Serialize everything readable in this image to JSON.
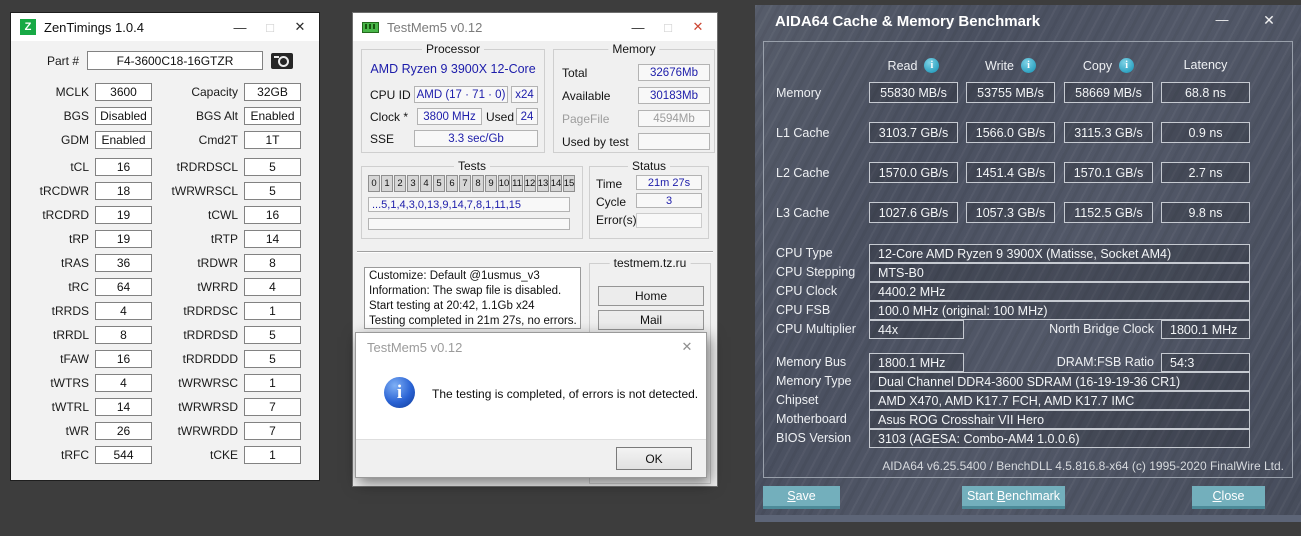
{
  "zentimings": {
    "icon_letter": "Z",
    "title": "ZenTimings 1.0.4",
    "minimize": "—",
    "maximize": "□",
    "close": "✕",
    "part_label": "Part #",
    "part_value": "F4-3600C18-16GTZR",
    "info_rows": [
      {
        "l1": "MCLK",
        "v1": "3600",
        "l2": "Capacity",
        "v2": "32GB"
      },
      {
        "l1": "BGS",
        "v1": "Disabled",
        "l2": "BGS Alt",
        "v2": "Enabled"
      },
      {
        "l1": "GDM",
        "v1": "Enabled",
        "l2": "Cmd2T",
        "v2": "1T"
      }
    ],
    "timing_rows": [
      {
        "l1": "tCL",
        "v1": "16",
        "l2": "tRDRDSCL",
        "v2": "5"
      },
      {
        "l1": "tRCDWR",
        "v1": "18",
        "l2": "tWRWRSCL",
        "v2": "5"
      },
      {
        "l1": "tRCDRD",
        "v1": "19",
        "l2": "tCWL",
        "v2": "16"
      },
      {
        "l1": "tRP",
        "v1": "19",
        "l2": "tRTP",
        "v2": "14"
      },
      {
        "l1": "tRAS",
        "v1": "36",
        "l2": "tRDWR",
        "v2": "8"
      },
      {
        "l1": "tRC",
        "v1": "64",
        "l2": "tWRRD",
        "v2": "4"
      },
      {
        "l1": "tRRDS",
        "v1": "4",
        "l2": "tRDRDSC",
        "v2": "1"
      },
      {
        "l1": "tRRDL",
        "v1": "8",
        "l2": "tRDRDSD",
        "v2": "5"
      },
      {
        "l1": "tFAW",
        "v1": "16",
        "l2": "tRDRDDD",
        "v2": "5"
      },
      {
        "l1": "tWTRS",
        "v1": "4",
        "l2": "tWRWRSC",
        "v2": "1"
      },
      {
        "l1": "tWTRL",
        "v1": "14",
        "l2": "tWRWRSD",
        "v2": "7"
      },
      {
        "l1": "tWR",
        "v1": "26",
        "l2": "tWRWRDD",
        "v2": "7"
      },
      {
        "l1": "tRFC",
        "v1": "544",
        "l2": "tCKE",
        "v2": "1"
      }
    ]
  },
  "testmem5": {
    "title": "TestMem5 v0.12",
    "minimize": "—",
    "maximize": "□",
    "close": "✕",
    "processor": {
      "group_label": "Processor",
      "cpu_name": "AMD Ryzen 9 3900X 12-Core",
      "cpu_id_label": "CPU ID",
      "cpu_id_value": "AMD  (17 · 71 · 0)",
      "cpu_id_mult": "x24",
      "clock_label": "Clock *",
      "clock_value": "3800 MHz",
      "used_label": "Used",
      "used_value": "24",
      "sse_label": "SSE",
      "sse_value": "3.3 sec/Gb"
    },
    "memory": {
      "group_label": "Memory",
      "rows": [
        {
          "label": "Total",
          "value": "32676Mb"
        },
        {
          "label": "Available",
          "value": "30183Mb"
        },
        {
          "label": "PageFile",
          "value": "4594Mb"
        },
        {
          "label": "Used by test",
          "value": ""
        }
      ]
    },
    "tests": {
      "group_label": "Tests",
      "buttons": [
        "0",
        "1",
        "2",
        "3",
        "4",
        "5",
        "6",
        "7",
        "8",
        "9",
        "10",
        "11",
        "12",
        "13",
        "14",
        "15"
      ],
      "sequence": "...5,1,4,3,0,13,9,14,7,8,1,11,15",
      "current": ""
    },
    "status": {
      "group_label": "Status",
      "time_label": "Time",
      "time_value": "21m 27s",
      "cycle_label": "Cycle",
      "cycle_value": "3",
      "errors_label": "Error(s)",
      "errors_value": ""
    },
    "log_lines": [
      "Customize: Default @1usmus_v3",
      "Information: The swap file is disabled.",
      "Start testing at 20:42, 1.1Gb x24",
      "Testing completed in 21m 27s, no errors."
    ],
    "links": {
      "group_label": "testmem.tz.ru",
      "home": "Home",
      "mail": "Mail"
    }
  },
  "dialog": {
    "title": "TestMem5 v0.12",
    "close": "✕",
    "message": "The testing is completed, of errors is not detected.",
    "ok": "OK"
  },
  "aida64": {
    "title": "AIDA64 Cache & Memory Benchmark",
    "minimize": "—",
    "close": "✕",
    "bench": {
      "headers": [
        "Read",
        "Write",
        "Copy",
        "Latency"
      ],
      "rows": [
        {
          "label": "Memory",
          "read": "55830 MB/s",
          "write": "53755 MB/s",
          "copy": "58669 MB/s",
          "latency": "68.8 ns"
        },
        {
          "label": "L1 Cache",
          "read": "3103.7 GB/s",
          "write": "1566.0 GB/s",
          "copy": "3115.3 GB/s",
          "latency": "0.9 ns"
        },
        {
          "label": "L2 Cache",
          "read": "1570.0 GB/s",
          "write": "1451.4 GB/s",
          "copy": "1570.1 GB/s",
          "latency": "2.7 ns"
        },
        {
          "label": "L3 Cache",
          "read": "1027.6 GB/s",
          "write": "1057.3 GB/s",
          "copy": "1152.5 GB/s",
          "latency": "9.8 ns"
        }
      ]
    },
    "info": {
      "cpu_type_label": "CPU Type",
      "cpu_type": "12-Core AMD Ryzen 9 3900X  (Matisse, Socket AM4)",
      "cpu_stepping_label": "CPU Stepping",
      "cpu_stepping": "MTS-B0",
      "cpu_clock_label": "CPU Clock",
      "cpu_clock": "4400.2 MHz",
      "cpu_fsb_label": "CPU FSB",
      "cpu_fsb": "100.0 MHz  (original: 100 MHz)",
      "cpu_mult_label": "CPU Multiplier",
      "cpu_mult": "44x",
      "nb_clock_label": "North Bridge Clock",
      "nb_clock": "1800.1 MHz",
      "mem_bus_label": "Memory Bus",
      "mem_bus": "1800.1 MHz",
      "dram_ratio_label": "DRAM:FSB Ratio",
      "dram_ratio": "54:3",
      "mem_type_label": "Memory Type",
      "mem_type": "Dual Channel DDR4-3600 SDRAM  (16-19-19-36 CR1)",
      "chipset_label": "Chipset",
      "chipset": "AMD X470, AMD K17.7 FCH, AMD K17.7 IMC",
      "motherboard_label": "Motherboard",
      "motherboard": "Asus ROG Crosshair VII Hero",
      "bios_label": "BIOS Version",
      "bios": "3103  (AGESA: Combo-AM4 1.0.0.6)"
    },
    "footer": "AIDA64 v6.25.5400 / BenchDLL 4.5.816.8-x64  (c) 1995-2020 FinalWire Ltd.",
    "buttons": {
      "save": {
        "accel": "S",
        "rest": "ave"
      },
      "start_pre": "Start ",
      "start_accel": "B",
      "start_rest": "enchmark",
      "close": {
        "accel": "C",
        "rest": "lose"
      }
    },
    "colors": {
      "accent": "#73afbc",
      "panel_bg": "#4b5160",
      "info_icon": "#2fa3c2",
      "value_navy": "#1c1caa"
    }
  }
}
